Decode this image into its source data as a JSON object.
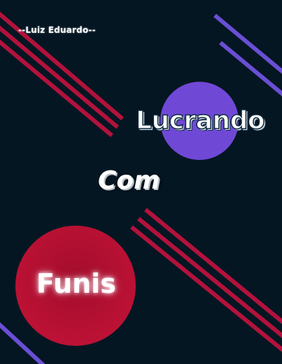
{
  "cover": {
    "author": "--Luiz Eduardo--",
    "title_words": [
      "Lucrando",
      "Com",
      "Funis"
    ],
    "colors": {
      "background": "#041622",
      "stripe_red": "#b3123c",
      "stripe_purple": "#6a4fd4",
      "circle_purple": "#7048d6",
      "circle_red": "#b0102f",
      "text": "#ffffff"
    }
  }
}
